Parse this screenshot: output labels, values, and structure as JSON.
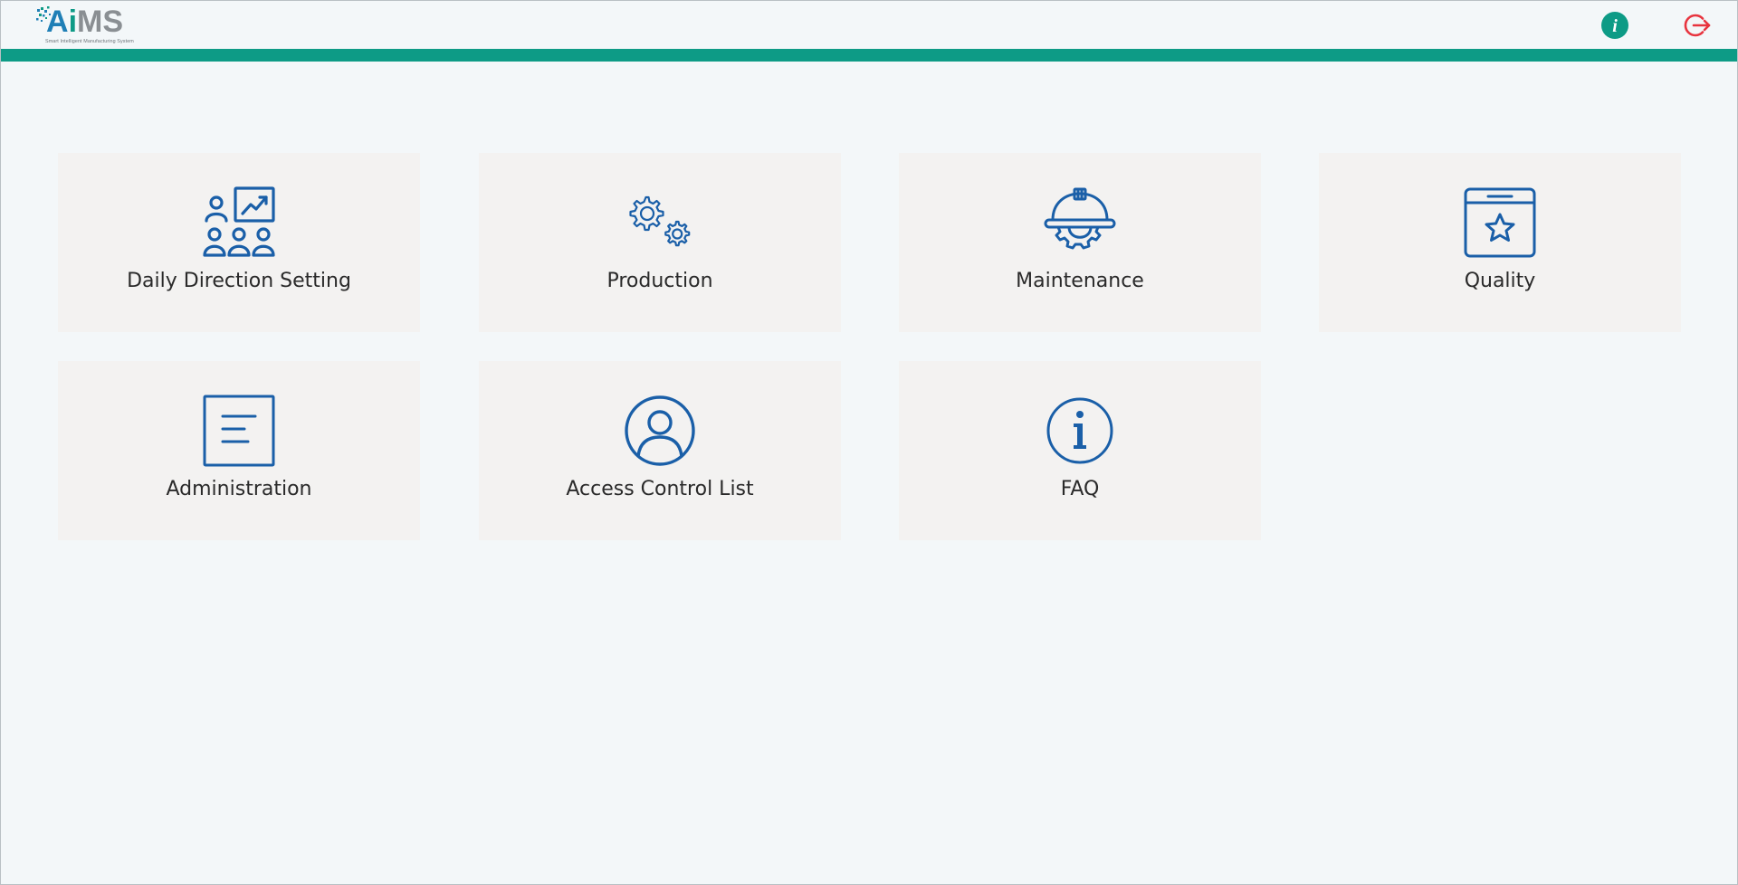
{
  "header": {
    "logo": {
      "letters": [
        "A",
        "i",
        "MS"
      ],
      "tagline": "Smart Intelligent Manufacturing System"
    },
    "info_icon": "info-icon",
    "logout_icon": "logout-icon"
  },
  "colors": {
    "teal": "#0d9b86",
    "icon_blue": "#1a5fa8",
    "logout_red": "#e8343f",
    "tile_bg": "#f3f2f1",
    "page_bg": "#f3f7f9"
  },
  "tiles": [
    {
      "label": "Daily Direction Setting",
      "icon": "team-chart-icon"
    },
    {
      "label": "Production",
      "icon": "gears-icon"
    },
    {
      "label": "Maintenance",
      "icon": "hardhat-icon"
    },
    {
      "label": "Quality",
      "icon": "window-star-icon"
    },
    {
      "label": "Administration",
      "icon": "document-icon"
    },
    {
      "label": "Access Control List",
      "icon": "user-circle-icon"
    },
    {
      "label": "FAQ",
      "icon": "info-circle-icon"
    }
  ]
}
